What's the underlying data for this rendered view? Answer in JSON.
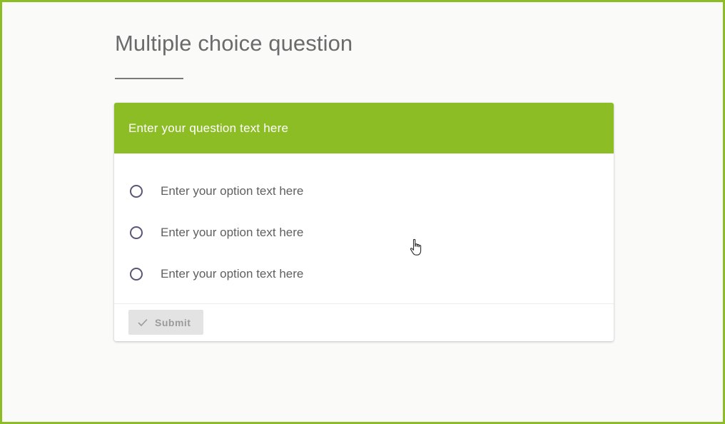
{
  "page": {
    "title": "Multiple choice question",
    "accent_color": "#8dbd25"
  },
  "question": {
    "text": "Enter your question text here"
  },
  "options": [
    {
      "label": "Enter your option text here",
      "selected": false
    },
    {
      "label": "Enter your option text here",
      "selected": false
    },
    {
      "label": "Enter your option text here",
      "selected": false
    }
  ],
  "submit": {
    "label": "Submit",
    "icon": "check-icon",
    "disabled": true
  },
  "cursor": {
    "icon": "hand-pointer-icon"
  }
}
